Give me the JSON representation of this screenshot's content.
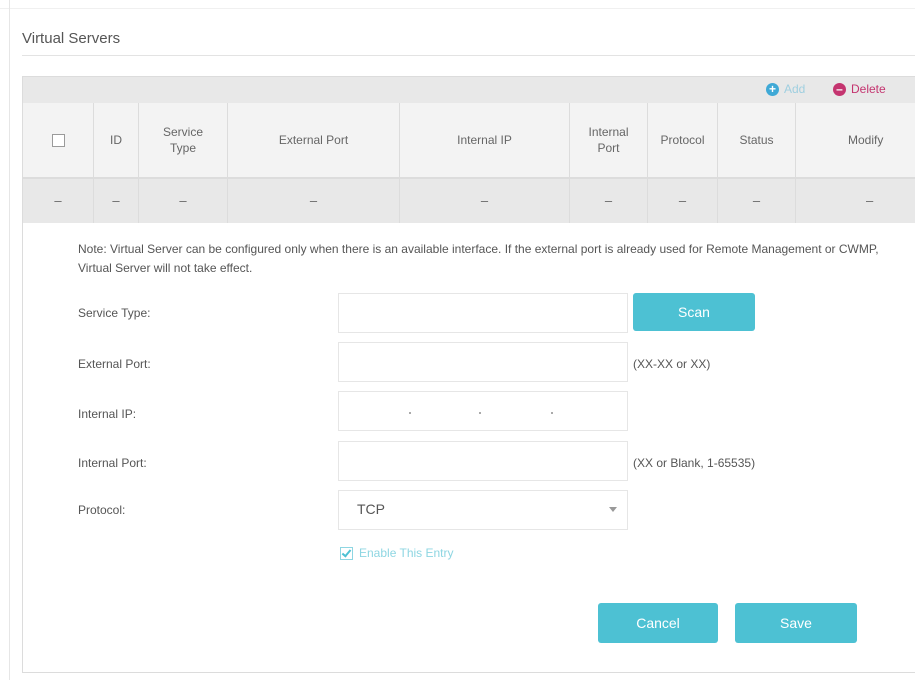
{
  "page": {
    "title": "Virtual Servers"
  },
  "toolbar": {
    "add_label": "Add",
    "add_icon": "+",
    "delete_label": "Delete",
    "delete_icon": "–"
  },
  "table": {
    "headers": [
      "",
      "ID",
      "Service\nType",
      "External Port",
      "Internal IP",
      "Internal\nPort",
      "Protocol",
      "Status",
      "Modify"
    ],
    "rows": [
      [
        "–",
        "–",
        "–",
        "–",
        "–",
        "–",
        "–",
        "–",
        "–"
      ]
    ]
  },
  "note": "Note: Virtual Server can be configured only when there is an available interface. If the external port is already used for Remote Management or CWMP, Virtual Server will not take effect.",
  "form": {
    "service_type_label": "Service Type:",
    "service_type_value": "",
    "scan_label": "Scan",
    "external_port_label": "External Port:",
    "external_port_value": "",
    "external_port_hint": "(XX-XX or XX)",
    "internal_ip_label": "Internal IP:",
    "internal_port_label": "Internal Port:",
    "internal_port_value": "",
    "internal_port_hint": "(XX or Blank, 1-65535)",
    "protocol_label": "Protocol:",
    "protocol_value": "TCP",
    "enable_label": "Enable This Entry",
    "enable_checked": true,
    "cancel_label": "Cancel",
    "save_label": "Save"
  },
  "colors": {
    "accent": "#4dc1d3",
    "delete": "#c4346f",
    "add": "#3fa9d6"
  }
}
